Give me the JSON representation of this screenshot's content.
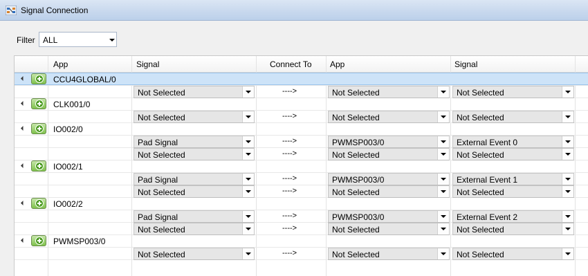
{
  "window": {
    "title": "Signal Connection"
  },
  "filter": {
    "label": "Filter",
    "value": "ALL"
  },
  "columns": [
    "App",
    "Signal",
    "Connect To",
    "App",
    "Signal"
  ],
  "groups": [
    {
      "app": "CCU4GLOBAL/0",
      "selected": true,
      "rows": [
        {
          "signal": "Not Selected",
          "connect": "---->",
          "target_app": "Not Selected",
          "target_signal": "Not Selected"
        }
      ]
    },
    {
      "app": "CLK001/0",
      "rows": [
        {
          "signal": "Not Selected",
          "connect": "---->",
          "target_app": "Not Selected",
          "target_signal": "Not Selected"
        }
      ]
    },
    {
      "app": "IO002/0",
      "rows": [
        {
          "signal": "Pad Signal",
          "connect": "---->",
          "target_app": "PWMSP003/0",
          "target_signal": "External Event 0"
        },
        {
          "signal": "Not Selected",
          "connect": "---->",
          "target_app": "Not Selected",
          "target_signal": "Not Selected"
        }
      ]
    },
    {
      "app": "IO002/1",
      "rows": [
        {
          "signal": "Pad Signal",
          "connect": "---->",
          "target_app": "PWMSP003/0",
          "target_signal": "External Event 1"
        },
        {
          "signal": "Not Selected",
          "connect": "---->",
          "target_app": "Not Selected",
          "target_signal": "Not Selected"
        }
      ]
    },
    {
      "app": "IO002/2",
      "rows": [
        {
          "signal": "Pad Signal",
          "connect": "---->",
          "target_app": "PWMSP003/0",
          "target_signal": "External Event 2"
        },
        {
          "signal": "Not Selected",
          "connect": "---->",
          "target_app": "Not Selected",
          "target_signal": "Not Selected"
        }
      ]
    },
    {
      "app": "PWMSP003/0",
      "rows": [
        {
          "signal": "Not Selected",
          "connect": "---->",
          "target_app": "Not Selected",
          "target_signal": "Not Selected"
        }
      ]
    }
  ],
  "icons": {
    "window": "signal-connection-icon",
    "add": "add-connection-icon",
    "expand": "expander-triangle-icon",
    "dropdown": "chevron-down-icon"
  }
}
